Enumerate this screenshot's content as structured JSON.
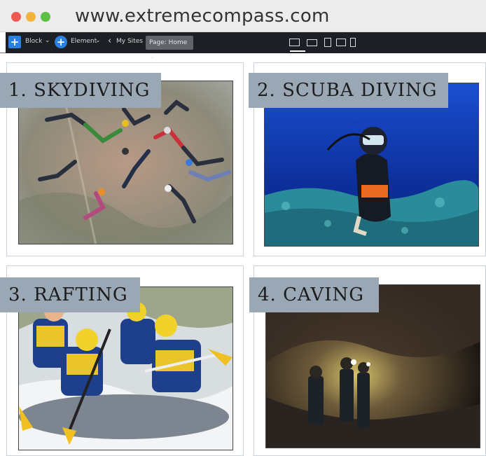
{
  "browser": {
    "url": "www.extremecompass.com"
  },
  "toolbar": {
    "block_label": "Block",
    "element_label": "Element",
    "my_sites_label": "My Sites",
    "page_select": "Page: Home",
    "devices": [
      "desktop-icon",
      "laptop-icon",
      "tablet-icon",
      "tablet-landscape-icon",
      "mobile-icon"
    ]
  },
  "cards": [
    {
      "title": "1. SKYDIVING",
      "image": "skydivers-formation-photo"
    },
    {
      "title": "2. SCUBA DIVING",
      "image": "scuba-diver-photo"
    },
    {
      "title": "3. RAFTING",
      "image": "white-water-rafting-photo"
    },
    {
      "title": "4. CAVING",
      "image": "cave-explorers-photo"
    }
  ],
  "colors": {
    "accent": "#2a7fe3",
    "toolbar": "#1d1f24",
    "label_bg": "#9aa8b6"
  }
}
